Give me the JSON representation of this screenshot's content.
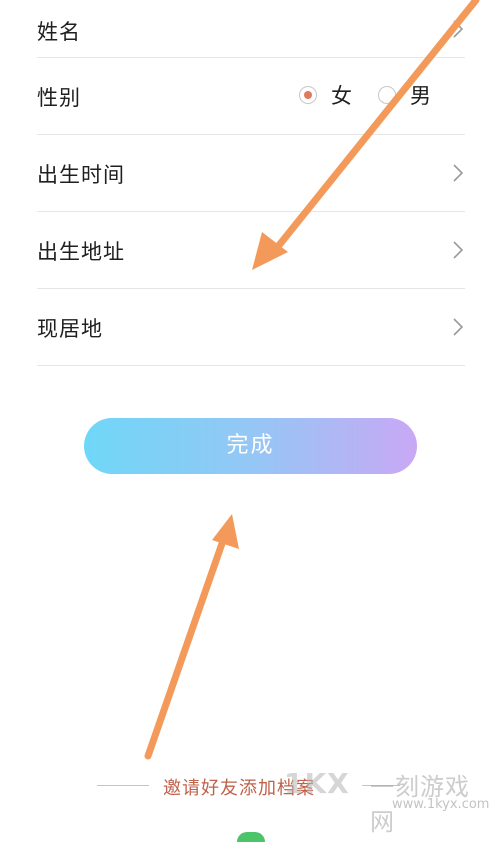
{
  "form": {
    "rows": [
      {
        "label": "姓名"
      },
      {
        "label": "性别"
      },
      {
        "label": "出生时间"
      },
      {
        "label": "出生地址"
      },
      {
        "label": "现居地"
      }
    ],
    "gender_options": [
      {
        "label": "女",
        "checked": true
      },
      {
        "label": "男",
        "checked": false
      }
    ]
  },
  "done_button": {
    "label": "完成"
  },
  "invite": {
    "label": "邀请好友添加档案"
  },
  "watermark": {
    "logo": "1KX",
    "name": "一刻游戏网",
    "url": "www.1kyx.com"
  },
  "colors": {
    "accent": "#e07a5f",
    "arrow": "#f39a5a",
    "button_gradient_start": "#6fd7f7",
    "button_gradient_end": "#c9a8f5"
  },
  "icons": {
    "row_chevron": "chevron-right-icon",
    "annotation": "arrow-icon"
  }
}
